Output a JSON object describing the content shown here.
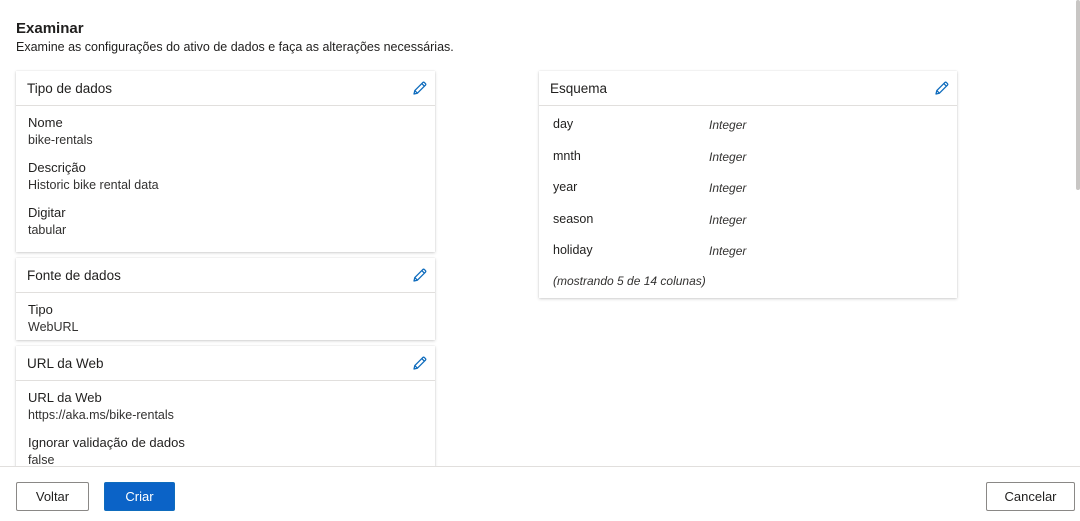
{
  "header": {
    "title": "Examinar",
    "subtitle": "Examine as configurações do ativo de dados e faça as alterações necessárias."
  },
  "cards": {
    "data_type": {
      "title": "Tipo de dados",
      "fields": [
        {
          "label": "Nome",
          "value": "bike-rentals"
        },
        {
          "label": "Descrição",
          "value": "Historic bike rental data"
        },
        {
          "label": "Digitar",
          "value": "tabular"
        }
      ]
    },
    "data_source": {
      "title": "Fonte de dados",
      "fields": [
        {
          "label": "Tipo",
          "value": "WebURL"
        }
      ]
    },
    "web_url": {
      "title": "URL da Web",
      "fields": [
        {
          "label": "URL da Web",
          "value": "https://aka.ms/bike-rentals"
        },
        {
          "label": "Ignorar validação de dados",
          "value": "false"
        }
      ]
    },
    "schema": {
      "title": "Esquema",
      "rows": [
        {
          "name": "day",
          "type": "Integer"
        },
        {
          "name": "mnth",
          "type": "Integer"
        },
        {
          "name": "year",
          "type": "Integer"
        },
        {
          "name": "season",
          "type": "Integer"
        },
        {
          "name": "holiday",
          "type": "Integer"
        }
      ],
      "note": "(mostrando 5 de 14 colunas)"
    }
  },
  "footer": {
    "back_label": "Voltar",
    "create_label": "Criar",
    "cancel_label": "Cancelar"
  },
  "icons": {
    "edit": "pencil-icon"
  },
  "colors": {
    "accent": "#0b63c7",
    "edit_icon": "#0f6cbd"
  }
}
